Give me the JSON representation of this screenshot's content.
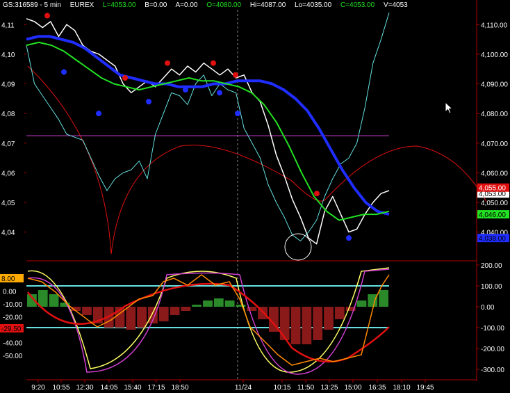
{
  "header": {
    "symbol": "GS:316589 - 5 min",
    "exchange": "EUREX",
    "last": "L=4053.00",
    "bid": "B=0.00",
    "ask": "A=0.00",
    "open": "O=4080.00",
    "high": "Hi=4087.00",
    "low": "Lo=4035.00",
    "close": "C=4053.00",
    "volume": "V=4053"
  },
  "colors": {
    "background": "#000000",
    "price": "#ffffff",
    "cyan": "#66e0e0",
    "blue_ma": "#1f2dff",
    "green_ma": "#22e022",
    "red": "#e01010",
    "magenta": "#d040d0",
    "osc_orange": "#ff8a00",
    "osc_yellow": "#ffff66"
  },
  "chart_data": [
    {
      "type": "line",
      "panel": "price",
      "y_axis_left": [
        "4,11",
        "4,10",
        "4,09",
        "4,08",
        "4,07",
        "4,06",
        "4,05",
        "4,04"
      ],
      "y_axis_right": [
        "4,110.00",
        "4,100.00",
        "4,090.00",
        "4,080.00",
        "4,070.00",
        "4,060.00",
        "4,050.00",
        "4,040.00"
      ],
      "ylim": [
        4031,
        4115
      ],
      "price_tags": [
        {
          "text": "4,053.00",
          "bg": "#ffffff",
          "fg": "#000000",
          "y": 4053
        },
        {
          "text": "4,046.00",
          "bg": "#22e022",
          "fg": "#000000",
          "y": 4046
        },
        {
          "text": "4,038.00",
          "bg": "#1f2dff",
          "fg": "#000000",
          "y": 4038
        },
        {
          "text": "4,055.00",
          "bg": "#e01010",
          "fg": "#ffffff",
          "y": 4055
        }
      ],
      "series": [
        {
          "role": "price",
          "color": "#ffffff",
          "values": [
            4112,
            4111,
            4109,
            4111,
            4106,
            4110,
            4108,
            4103,
            4101,
            4100,
            4098,
            4096,
            4090,
            4087,
            4089,
            4091,
            4089,
            4092,
            4095,
            4093,
            4096,
            4094,
            4097,
            4095,
            4093,
            4095,
            4092,
            4093,
            4087,
            4084,
            4076,
            4066,
            4059,
            4051,
            4045,
            4038,
            4036,
            4047,
            4052,
            4046,
            4040,
            4041,
            4046,
            4050,
            4053,
            4054
          ]
        },
        {
          "role": "cyan",
          "color": "#66e0e0",
          "values": [
            4103,
            4090,
            4086,
            4082,
            4078,
            4073,
            4072,
            4071,
            4065,
            4059,
            4054,
            4058,
            4060,
            4061,
            4064,
            4058,
            4073,
            4080,
            4087,
            4086,
            4083,
            4090,
            4093,
            4086,
            4090,
            4088,
            4087,
            4075,
            4070,
            4065,
            4056,
            4050,
            4045,
            4039,
            4037,
            4040,
            4044,
            4052,
            4058,
            4063,
            4065,
            4070,
            4082,
            4097,
            4105,
            4114
          ]
        },
        {
          "role": "blue_ma",
          "color": "#1f2dff",
          "values": [
            4105,
            4106,
            4106,
            4105,
            4104,
            4102,
            4099,
            4096,
            4093,
            4092,
            4091,
            4090,
            4090,
            4089,
            4089,
            4089,
            4090,
            4090,
            4091,
            4091,
            4091,
            4090,
            4088,
            4085,
            4081,
            4075,
            4068,
            4061,
            4055,
            4050,
            4047,
            4046
          ]
        },
        {
          "role": "green_ma",
          "color": "#22e022",
          "values": [
            4103,
            4104,
            4103,
            4101,
            4098,
            4095,
            4092,
            4090,
            4089,
            4088,
            4089,
            4090,
            4091,
            4092,
            4091,
            4091,
            4090,
            4089,
            4087,
            4083,
            4077,
            4069,
            4060,
            4052,
            4047,
            4044,
            4045,
            4046,
            4046,
            4047
          ]
        }
      ],
      "horizontal_lines": [
        {
          "color": "#d040d0",
          "y": 4072.5
        }
      ]
    },
    {
      "type": "bar",
      "panel": "oscillator",
      "y_axis_left": [
        "8.00",
        "0.00",
        "-10.00",
        "-20.00",
        "-30.00",
        "-40.00",
        "-50.00"
      ],
      "y_axis_right": [
        "200.00",
        "100.00",
        "0.00",
        "-100.00",
        "-200.00",
        "-300.00"
      ],
      "ylim": [
        -350,
        210
      ],
      "tags": [
        {
          "text": "8.00",
          "bg": "#ffaa00",
          "y": 145
        },
        {
          "text": "-29.50",
          "bg": "#e01010",
          "y": -110
        }
      ],
      "reference_lines": [
        100,
        -100
      ],
      "histogram": [
        60,
        80,
        60,
        20,
        -20,
        -40,
        -80,
        -100,
        -100,
        -110,
        -100,
        -80,
        -70,
        -40,
        -20,
        10,
        30,
        40,
        30,
        10,
        -20,
        -60,
        -120,
        -160,
        -180,
        -180,
        -160,
        -110,
        -60,
        -20,
        30,
        60,
        80
      ]
    }
  ],
  "x_axis": {
    "labels": [
      "9:20",
      "10:55",
      "12:30",
      "14:05",
      "15:40",
      "17:15",
      "18:50",
      "11/24",
      "10:15",
      "11:50",
      "13:25",
      "15:00",
      "16:35",
      "18:10",
      "19:45"
    ]
  }
}
